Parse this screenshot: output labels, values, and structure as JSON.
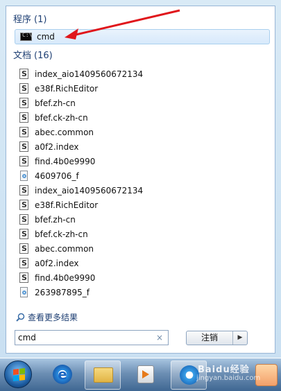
{
  "programs": {
    "header": "程序",
    "count": "(1)",
    "items": [
      {
        "label": "cmd",
        "icon": "command-prompt-icon"
      }
    ]
  },
  "documents": {
    "header": "文档",
    "count": "(16)",
    "items": [
      {
        "label": "index_aio1409560672134",
        "icon": "script-file-icon"
      },
      {
        "label": "e38f.RichEditor",
        "icon": "script-file-icon"
      },
      {
        "label": "bfef.zh-cn",
        "icon": "script-file-icon"
      },
      {
        "label": "bfef.ck-zh-cn",
        "icon": "script-file-icon"
      },
      {
        "label": "abec.common",
        "icon": "script-file-icon"
      },
      {
        "label": "a0f2.index",
        "icon": "script-file-icon"
      },
      {
        "label": "find.4b0e9990",
        "icon": "script-file-icon"
      },
      {
        "label": "4609706_f",
        "icon": "settings-file-icon"
      },
      {
        "label": "index_aio1409560672134",
        "icon": "script-file-icon"
      },
      {
        "label": "e38f.RichEditor",
        "icon": "script-file-icon"
      },
      {
        "label": "bfef.zh-cn",
        "icon": "script-file-icon"
      },
      {
        "label": "bfef.ck-zh-cn",
        "icon": "script-file-icon"
      },
      {
        "label": "abec.common",
        "icon": "script-file-icon"
      },
      {
        "label": "a0f2.index",
        "icon": "script-file-icon"
      },
      {
        "label": "find.4b0e9990",
        "icon": "script-file-icon"
      },
      {
        "label": "263987895_f",
        "icon": "settings-file-icon"
      }
    ]
  },
  "see_more": {
    "label": "查看更多结果",
    "icon": "search-icon"
  },
  "search": {
    "value": "cmd",
    "clear": "×"
  },
  "shutdown": {
    "label": "注销",
    "arrow": "▶"
  },
  "watermark": {
    "line1": "Baidu经验",
    "line2": "jingyan.baidu.com"
  },
  "colors": {
    "accent": "#1e3f73",
    "highlight": "#d7e9fb",
    "arrow": "#e0161b",
    "taskbar": "#3f6792"
  }
}
